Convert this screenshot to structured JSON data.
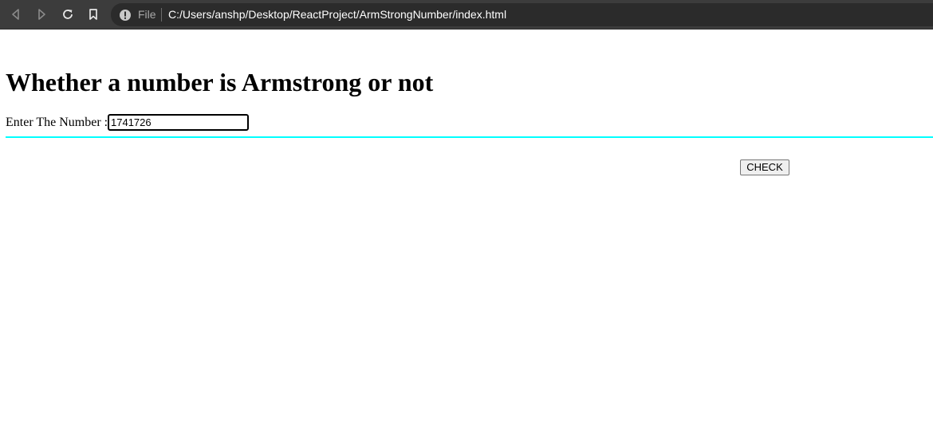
{
  "browser": {
    "scheme_label": "File",
    "url": "C:/Users/anshp/Desktop/ReactProject/ArmStrongNumber/index.html",
    "icons": [
      "back-icon",
      "forward-icon",
      "reload-icon",
      "bookmark-icon",
      "info-icon"
    ],
    "bar_color": "#3c3c3c"
  },
  "main": {
    "title": "Whether a number is Armstrong or not",
    "input_label": "Enter The Number :",
    "input_value": "1741726",
    "check_button_label": "CHECK",
    "rule_color": "#00ffff"
  }
}
